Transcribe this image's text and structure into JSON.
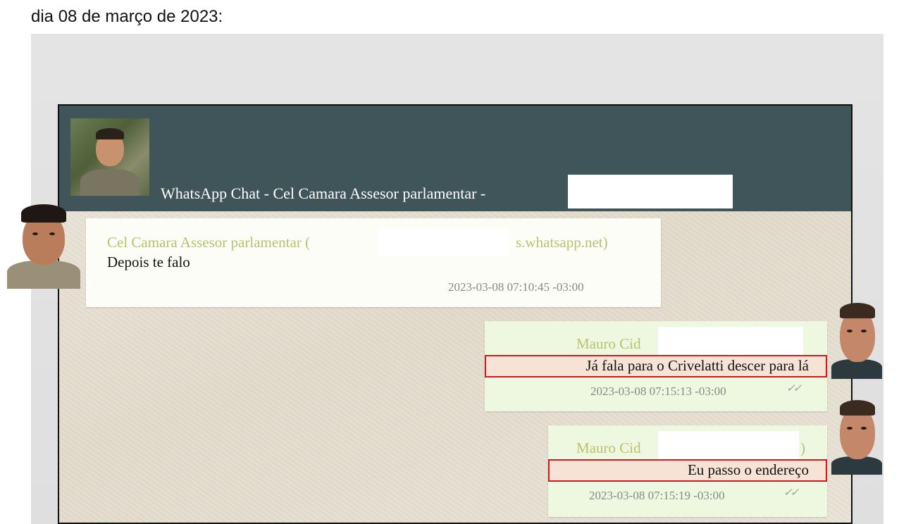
{
  "caption": "dia 08 de março de 2023:",
  "header": {
    "title": "WhatsApp Chat - Cel Camara Assesor parlamentar -"
  },
  "messages": [
    {
      "direction": "incoming",
      "sender": "Cel Camara Assesor parlamentar (",
      "sender_suffix": "s.whatsapp.net)",
      "text": "Depois te falo",
      "timestamp": "2023-03-08 07:10:45 -03:00"
    },
    {
      "direction": "outgoing",
      "sender": "Mauro Cid",
      "text": "Já fala para o Crivelatti descer para lá",
      "timestamp": "2023-03-08 07:15:13 -03:00",
      "ticks": "✓✓"
    },
    {
      "direction": "outgoing",
      "sender": "Mauro Cid",
      "sender_suffix": ")",
      "text": "Eu passo o endereço",
      "timestamp": "2023-03-08 07:15:19 -03:00",
      "ticks": "✓✓"
    }
  ],
  "colors": {
    "header_bg": "#3f5559",
    "incoming_bubble": "#fdfdf8",
    "outgoing_bubble": "#eef7e0",
    "sender_name": "#b9c26a",
    "highlight_border": "#d11a1a"
  },
  "icons": {
    "header_avatar": "contact-photo",
    "left_portrait": "person-portrait",
    "right_portrait": "person-portrait"
  }
}
